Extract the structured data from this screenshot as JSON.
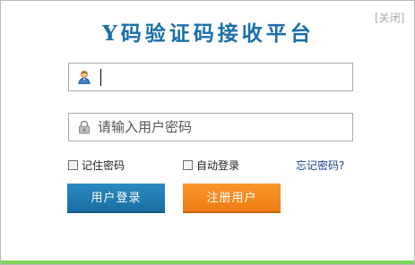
{
  "header": {
    "close_label": "[关闭]",
    "title": "Y码验证码接收平台"
  },
  "form": {
    "username": {
      "value": "",
      "placeholder": "",
      "icon": "user-icon"
    },
    "password": {
      "value": "",
      "placeholder": "请输入用户密码",
      "icon": "lock-icon"
    },
    "remember_label": "记住密码",
    "remember_checked": false,
    "auto_login_label": "自动登录",
    "auto_login_checked": false,
    "forgot_label": "忘记密码?"
  },
  "buttons": {
    "login_label": "用户登录",
    "register_label": "注册用户"
  },
  "colors": {
    "title": "#1b6fa8",
    "login_button": "#1a7ab5",
    "register_button": "#f28a1e",
    "bottom_bar": "#7fd45a"
  }
}
